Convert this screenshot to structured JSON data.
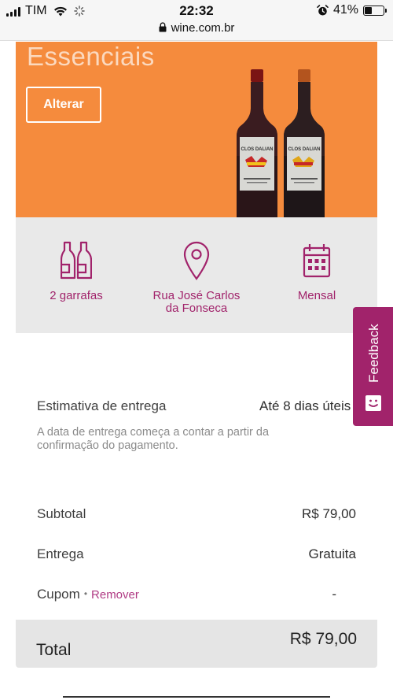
{
  "status_bar": {
    "carrier": "TIM",
    "time": "22:32",
    "battery": "41%",
    "battery_level": 0.41,
    "url": "wine.com.br"
  },
  "hero": {
    "title": "Essenciais",
    "change_button": "Alterar",
    "bottle_label": "CLOS DALIAN"
  },
  "info": {
    "bottles": "2 garrafas",
    "address_line1": "Rua José Carlos",
    "address_line2": "da Fonseca",
    "frequency": "Mensal"
  },
  "feedback": {
    "label": "Feedback"
  },
  "delivery": {
    "label": "Estimativa de entrega",
    "value": "Até 8 dias úteis",
    "note": "A data de entrega começa a contar a partir da confirmação do pagamento."
  },
  "summary": {
    "subtotal_label": "Subtotal",
    "subtotal_value": "R$ 79,00",
    "shipping_label": "Entrega",
    "shipping_value": "Gratuita",
    "coupon_label": "Cupom",
    "coupon_separator": "•",
    "coupon_remove": "Remover",
    "coupon_value": "-",
    "total_label": "Total",
    "total_value": "R$ 79,00"
  },
  "colors": {
    "hero_orange": "#f58b3d",
    "brand_purple": "#a1236b",
    "info_grey": "#e9e9e9"
  },
  "icons": [
    "signal-icon",
    "wifi-icon",
    "loading-icon",
    "lock-icon",
    "alarm-icon",
    "battery-icon",
    "bottles-icon",
    "location-pin-icon",
    "calendar-icon",
    "feedback-smile-icon"
  ]
}
